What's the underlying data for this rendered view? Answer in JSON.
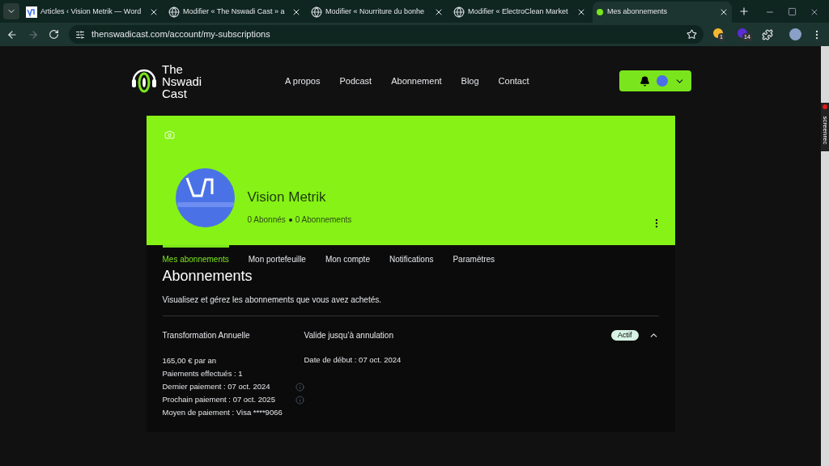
{
  "browser": {
    "tabs": [
      {
        "title": "Articles ‹ Vision Metrik — Word",
        "selected": false,
        "kind": "wave"
      },
      {
        "title": "Modifier « The Nswadi Cast » a",
        "selected": false,
        "kind": "globe"
      },
      {
        "title": "Modifier « Nourriture du bonhe",
        "selected": false,
        "kind": "globe"
      },
      {
        "title": "Modifier « ElectroClean Market",
        "selected": false,
        "kind": "globe"
      },
      {
        "title": "Mes abonnements",
        "selected": true,
        "kind": "site"
      }
    ],
    "url": "thenswadicast.com/account/my-subscriptions",
    "extension_badges": [
      "1",
      "14"
    ]
  },
  "site": {
    "logo": [
      "The",
      "Nswadi",
      "Cast"
    ],
    "nav": [
      "A propos",
      "Podcast",
      "Abonnement",
      "Blog",
      "Contact"
    ]
  },
  "profile": {
    "name": "Vision Metrik",
    "followers": "0 Abonnés",
    "following": "0 Abonnements"
  },
  "account_tabs": [
    {
      "label": "Mes abonnements",
      "selected": true
    },
    {
      "label": "Mon portefeuille",
      "selected": false
    },
    {
      "label": "Mon compte",
      "selected": false
    },
    {
      "label": "Notifications",
      "selected": false
    },
    {
      "label": "Paramètres",
      "selected": false
    }
  ],
  "page": {
    "title": "Abonnements",
    "subtitle": "Visualisez et gérez les abonnements que vous avez achetés."
  },
  "subscription": {
    "plan": "Transformation Annuelle",
    "validity": "Valide jusqu’à annulation",
    "status": "Actif",
    "expanded": true,
    "details": [
      {
        "text": "165,00 € par an",
        "info": false
      },
      {
        "text": "Paiements effectués : 1",
        "info": false
      },
      {
        "text": "Dernier paiement : 07 oct. 2024",
        "info": true
      },
      {
        "text": "Prochain paiement : 07 oct. 2025",
        "info": true
      },
      {
        "text": "Moyen de paiement : Visa ****9066",
        "info": false
      }
    ],
    "start_date": "Date de début : 07 oct. 2024"
  },
  "sidebar_widget": {
    "label": "screenrec"
  }
}
